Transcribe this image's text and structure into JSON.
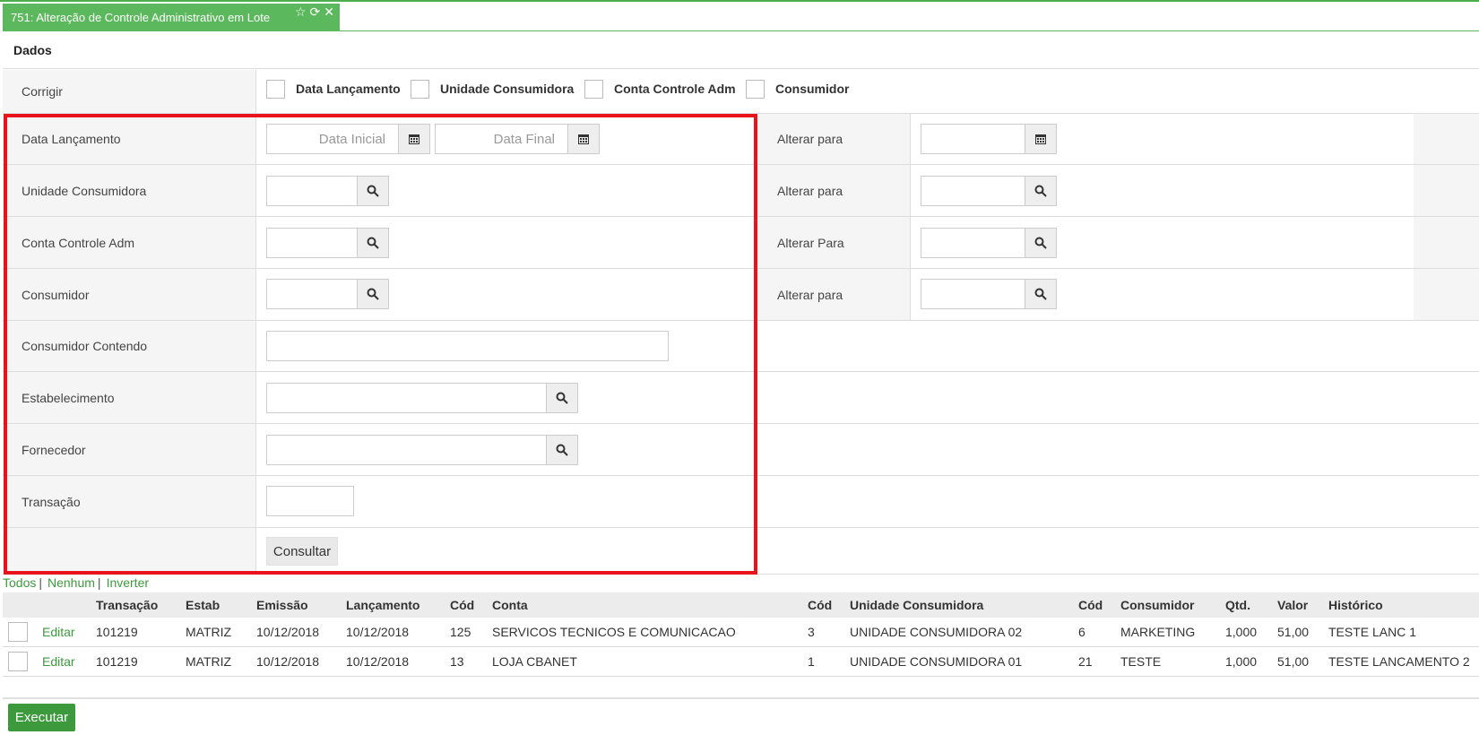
{
  "tab": {
    "title": "751: Alteração de Controle Administrativo em Lote"
  },
  "section": {
    "title": "Dados"
  },
  "corrigir": {
    "label": "Corrigir",
    "options": [
      "Data Lançamento",
      "Unidade Consumidora",
      "Conta Controle Adm",
      "Consumidor"
    ]
  },
  "form": {
    "data_lancamento": "Data Lançamento",
    "data_inicial_placeholder": "Data Inicial",
    "data_final_placeholder": "Data Final",
    "unidade_consumidora": "Unidade Consumidora",
    "conta_controle_adm": "Conta Controle Adm",
    "consumidor": "Consumidor",
    "consumidor_contendo": "Consumidor Contendo",
    "estabelecimento": "Estabelecimento",
    "fornecedor": "Fornecedor",
    "transacao": "Transação",
    "consultar_button": "Consultar"
  },
  "alterar": {
    "data_lancamento": "Alterar para",
    "unidade_consumidora": "Alterar para",
    "conta_controle_adm": "Alterar Para",
    "consumidor": "Alterar para"
  },
  "selection": {
    "todos": "Todos",
    "nenhum": "Nenhum",
    "inverter": "Inverter"
  },
  "table": {
    "headers": [
      "Transação",
      "Estab",
      "Emissão",
      "Lançamento",
      "Cód",
      "Conta",
      "Cód",
      "Unidade Consumidora",
      "Cód",
      "Consumidor",
      "Qtd.",
      "Valor",
      "Histórico"
    ],
    "edit_label": "Editar",
    "rows": [
      [
        "101219",
        "MATRIZ",
        "10/12/2018",
        "10/12/2018",
        "125",
        "SERVICOS TECNICOS E COMUNICACAO",
        "3",
        "UNIDADE CONSUMIDORA 02",
        "6",
        "MARKETING",
        "1,000",
        "51,00",
        "TESTE LANC 1"
      ],
      [
        "101219",
        "MATRIZ",
        "10/12/2018",
        "10/12/2018",
        "13",
        "LOJA CBANET",
        "1",
        "UNIDADE CONSUMIDORA 01",
        "21",
        "TESTE",
        "1,000",
        "51,00",
        "TESTE LANCAMENTO 2"
      ]
    ]
  },
  "footer": {
    "execute_button": "Executar"
  },
  "colors": {
    "accent": "#5cb85c",
    "highlight_border": "#e8141b",
    "link": "#3c9a3c"
  }
}
